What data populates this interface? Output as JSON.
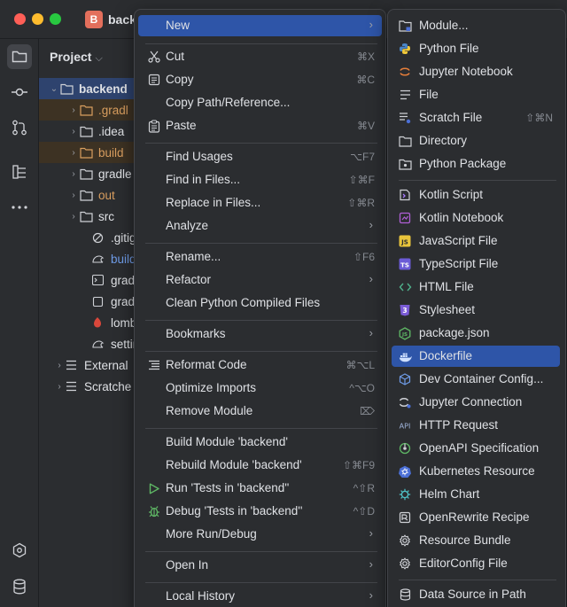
{
  "window": {
    "title": "back",
    "badge": "B"
  },
  "project_panel": {
    "title": "Project",
    "tree": [
      {
        "label": "backend",
        "arrow": "expanded",
        "style": "root"
      },
      {
        "label": ".gradl",
        "arrow": "collapsed",
        "style": "orange"
      },
      {
        "label": ".idea",
        "arrow": "collapsed",
        "style": "normal"
      },
      {
        "label": "build",
        "arrow": "collapsed",
        "style": "orange"
      },
      {
        "label": "gradle",
        "arrow": "collapsed",
        "style": "normal"
      },
      {
        "label": "out",
        "arrow": "collapsed",
        "style": "orange-text"
      },
      {
        "label": "src",
        "arrow": "collapsed",
        "style": "normal"
      },
      {
        "label": ".gitigr",
        "arrow": "none",
        "style": "normal"
      },
      {
        "label": "build.",
        "arrow": "none",
        "style": "blue"
      },
      {
        "label": "gradle",
        "arrow": "none",
        "style": "normal"
      },
      {
        "label": "gradle",
        "arrow": "none",
        "style": "normal"
      },
      {
        "label": "lombo",
        "arrow": "none",
        "style": "normal"
      },
      {
        "label": "settin",
        "arrow": "none",
        "style": "normal"
      },
      {
        "label": "External",
        "arrow": "collapsed",
        "style": "normal"
      },
      {
        "label": "Scratche",
        "arrow": "collapsed",
        "style": "normal"
      }
    ]
  },
  "context_menu": {
    "new": "New",
    "cut": "Cut",
    "cut_sc": "⌘X",
    "copy": "Copy",
    "copy_sc": "⌘C",
    "copy_path": "Copy Path/Reference...",
    "paste": "Paste",
    "paste_sc": "⌘V",
    "find_usages": "Find Usages",
    "find_usages_sc": "⌥F7",
    "find_in_files": "Find in Files...",
    "find_in_files_sc": "⇧⌘F",
    "replace_in_files": "Replace in Files...",
    "replace_in_files_sc": "⇧⌘R",
    "analyze": "Analyze",
    "rename": "Rename...",
    "rename_sc": "⇧F6",
    "refactor": "Refactor",
    "clean_python": "Clean Python Compiled Files",
    "bookmarks": "Bookmarks",
    "reformat": "Reformat Code",
    "reformat_sc": "⌘⌥L",
    "optimize_imports": "Optimize Imports",
    "optimize_imports_sc": "^⌥O",
    "remove_module": "Remove Module",
    "remove_module_sc": "⌦",
    "build_module": "Build Module 'backend'",
    "rebuild_module": "Rebuild Module 'backend'",
    "rebuild_module_sc": "⇧⌘F9",
    "run_tests": "Run 'Tests in 'backend''",
    "run_tests_sc": "^⇧R",
    "debug_tests": "Debug 'Tests in 'backend''",
    "debug_tests_sc": "^⇧D",
    "more_run": "More Run/Debug",
    "open_in": "Open In",
    "local_history": "Local History"
  },
  "new_submenu": {
    "module": "Module...",
    "python_file": "Python File",
    "jupyter_notebook": "Jupyter Notebook",
    "file": "File",
    "scratch_file": "Scratch File",
    "scratch_file_sc": "⇧⌘N",
    "directory": "Directory",
    "python_package": "Python Package",
    "kotlin_script": "Kotlin Script",
    "kotlin_notebook": "Kotlin Notebook",
    "javascript_file": "JavaScript File",
    "typescript_file": "TypeScript File",
    "html_file": "HTML File",
    "stylesheet": "Stylesheet",
    "package_json": "package.json",
    "dockerfile": "Dockerfile",
    "dev_container": "Dev Container Config...",
    "jupyter_connection": "Jupyter Connection",
    "http_request": "HTTP Request",
    "openapi": "OpenAPI Specification",
    "kubernetes": "Kubernetes Resource",
    "helm_chart": "Helm Chart",
    "openrewrite": "OpenRewrite Recipe",
    "resource_bundle": "Resource Bundle",
    "editorconfig": "EditorConfig File",
    "data_source": "Data Source in Path"
  },
  "colors": {
    "accent": "#2e55a8",
    "menu_bg": "#2b2d30",
    "folder_hl": "#3d3223"
  }
}
